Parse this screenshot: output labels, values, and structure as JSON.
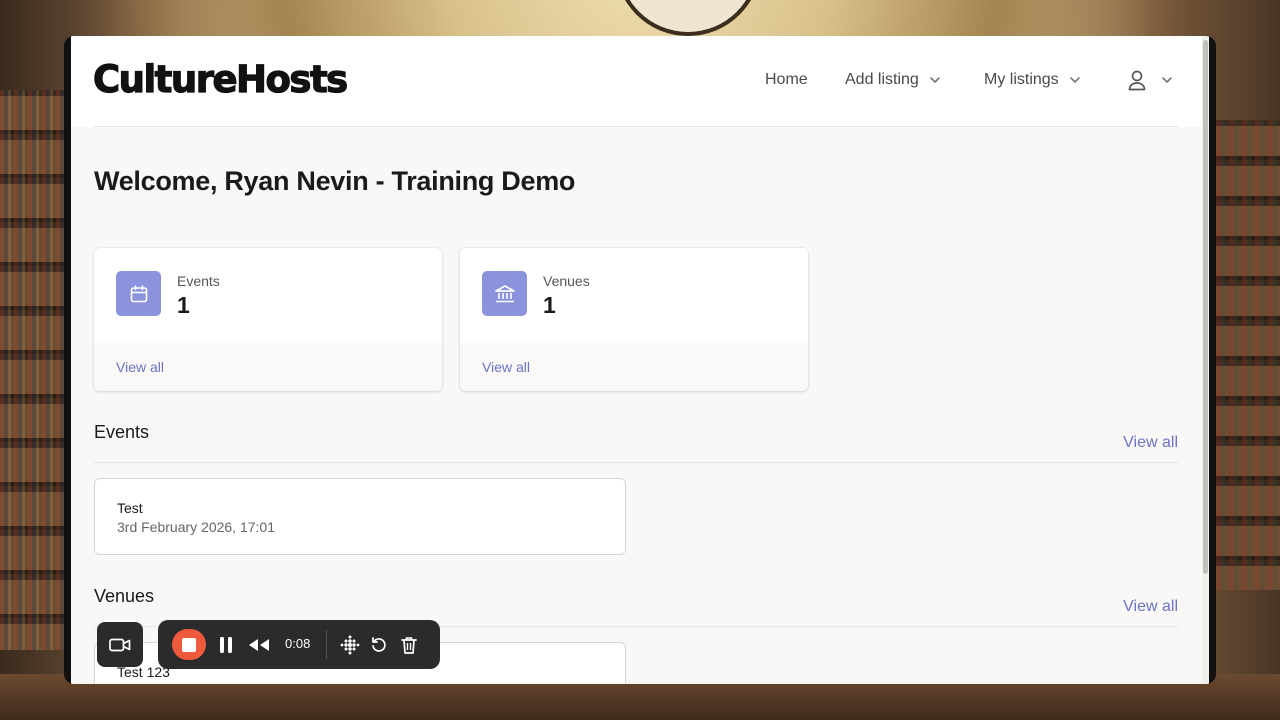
{
  "header": {
    "logo": "CultureHosts",
    "nav": {
      "home": "Home",
      "add_listing": "Add listing",
      "my_listings": "My listings"
    }
  },
  "welcome": "Welcome, Ryan Nevin - Training Demo",
  "stats": [
    {
      "label": "Events",
      "value": "1",
      "link": "View all",
      "icon": "calendar-icon"
    },
    {
      "label": "Venues",
      "value": "1",
      "link": "View all",
      "icon": "building-icon"
    }
  ],
  "sections": {
    "events": {
      "title": "Events",
      "view_all": "View all",
      "items": [
        {
          "title": "Test",
          "subtitle": "3rd February 2026, 17:01"
        }
      ]
    },
    "venues": {
      "title": "Venues",
      "view_all": "View all",
      "items": [
        {
          "title": "Test 123"
        }
      ]
    }
  },
  "recorder": {
    "time": "0:08"
  },
  "colors": {
    "accent": "#8b93dc",
    "link": "#6b73c6",
    "record": "#f05a3c"
  }
}
